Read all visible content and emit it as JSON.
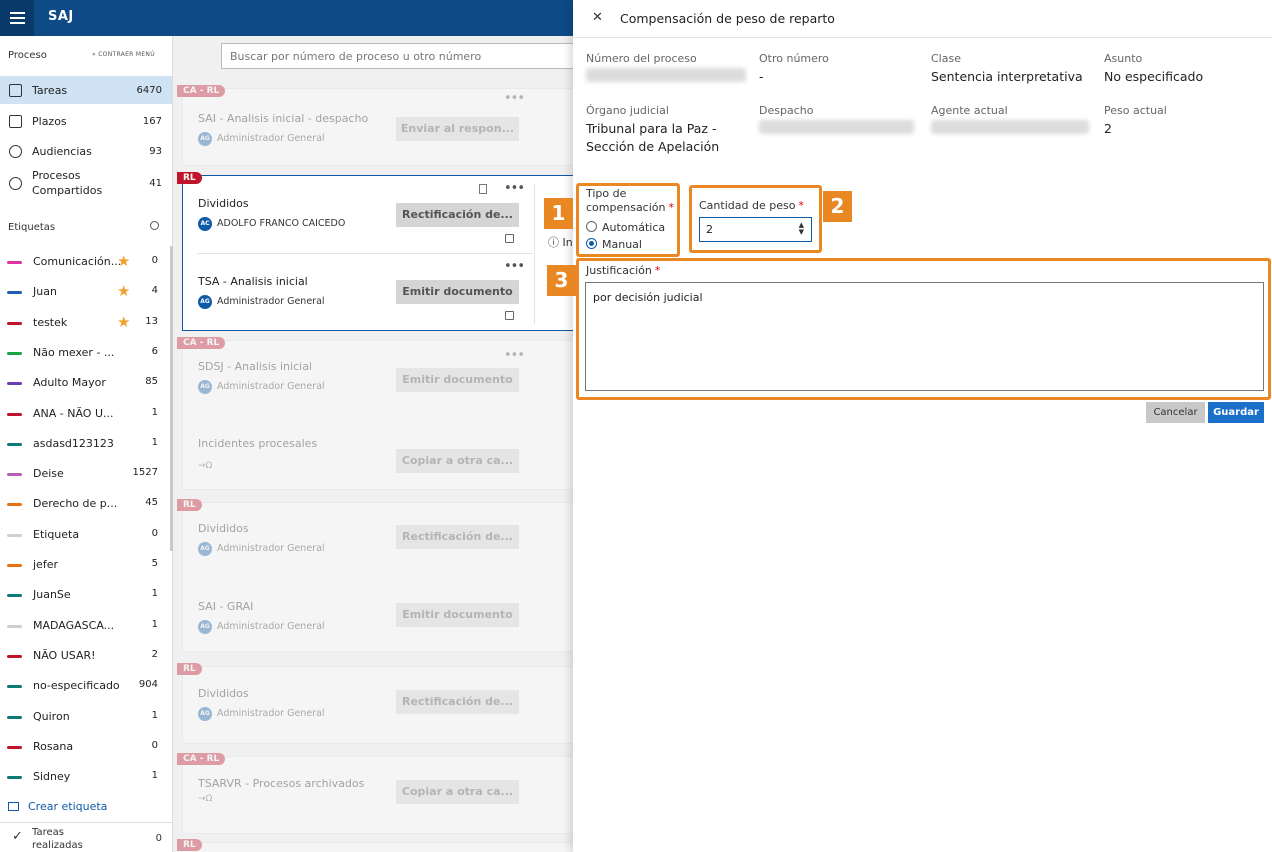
{
  "app": {
    "name": "SAJ"
  },
  "sidebar": {
    "title": "Proceso",
    "collapse_label": "CONTRAER MENÚ",
    "nav": [
      {
        "label": "Tareas",
        "count": "6470",
        "active": true
      },
      {
        "label": "Plazos",
        "count": "167"
      },
      {
        "label": "Audiencias",
        "count": "93"
      },
      {
        "label": "Procesos Compartidos",
        "count": "41"
      }
    ],
    "tags_title": "Etiquetas",
    "tags": [
      {
        "label": "Comunicación...",
        "count": "0",
        "color": "#e0339a",
        "starred": true
      },
      {
        "label": "Juan",
        "count": "4",
        "color": "#1e5fb4",
        "starred": true
      },
      {
        "label": "testek",
        "count": "13",
        "color": "#c0142a",
        "starred": true
      },
      {
        "label": "Não mexer - ...",
        "count": "6",
        "color": "#1aa34a"
      },
      {
        "label": "Adulto Mayor",
        "count": "85",
        "color": "#6a3fb0"
      },
      {
        "label": "ANA - NÃO U...",
        "count": "1",
        "color": "#c0142a"
      },
      {
        "label": "asdasd123123",
        "count": "1",
        "color": "#0b7a78"
      },
      {
        "label": "Deise",
        "count": "1527",
        "color": "#b45fb4"
      },
      {
        "label": "Derecho de p...",
        "count": "45",
        "color": "#e8700f"
      },
      {
        "label": "Etiqueta",
        "count": "0",
        "color": "#d0d0d0"
      },
      {
        "label": "jefer",
        "count": "5",
        "color": "#e8700f"
      },
      {
        "label": "JuanSe",
        "count": "1",
        "color": "#0b7a78"
      },
      {
        "label": "MADAGASCA...",
        "count": "1",
        "color": "#d0d0d0"
      },
      {
        "label": "NÃO USAR!",
        "count": "2",
        "color": "#c0142a"
      },
      {
        "label": "no-especificado",
        "count": "904",
        "color": "#0b7a78"
      },
      {
        "label": "Quiron",
        "count": "1",
        "color": "#0b7a78"
      },
      {
        "label": "Rosana",
        "count": "0",
        "color": "#c0142a"
      },
      {
        "label": "Sidney",
        "count": "1",
        "color": "#0b7a78"
      }
    ],
    "create_tag": "Crear etiqueta",
    "done_label": "Tareas realizadas",
    "done_count": "0"
  },
  "search": {
    "placeholder": "Buscar por número de proceso u otro número"
  },
  "cards": [
    {
      "tag": "CA - RL",
      "task": "SAI - Analisis inicial - despacho",
      "avatar": "AG",
      "user": "Administrador General",
      "button": "Enviar al respon..."
    },
    {
      "tag": "RL",
      "task1": "Divididos",
      "avatar1": "AC",
      "user1": "ADOLFO FRANCO CAICEDO",
      "button1": "Rectificación de...",
      "task2": "TSA - Analisis inicial",
      "avatar2": "AG",
      "user2": "Administrador General",
      "button2": "Emitir documento",
      "info": "In"
    },
    {
      "tag": "CA - RL",
      "task1": "SDSJ - Analisis inicial",
      "avatar1": "AG",
      "user1": "Administrador General",
      "button1": "Emitir documento",
      "task2": "Incidentes procesales",
      "button2": "Copiar a otra ca..."
    },
    {
      "tag": "RL",
      "task1": "Divididos",
      "avatar1": "AG",
      "user1": "Administrador General",
      "button1": "Rectificación de...",
      "task2": "SAI - GRAI",
      "avatar2": "AG",
      "user2": "Administrador General",
      "button2": "Emitir documento"
    },
    {
      "tag": "RL",
      "task": "Divididos",
      "avatar": "AG",
      "user": "Administrador General",
      "button": "Rectificación de..."
    },
    {
      "tag": "CA - RL",
      "task": "TSARVR - Procesos archivados",
      "button": "Copiar a otra ca..."
    },
    {
      "tag": "RL"
    }
  ],
  "dialog": {
    "title": "Compensación de peso de reparto",
    "fields": {
      "numero_label": "Número del proceso",
      "otro_label": "Otro número",
      "otro_value": "-",
      "clase_label": "Clase",
      "clase_value": "Sentencia interpretativa",
      "asunto_label": "Asunto",
      "asunto_value": "No especificado",
      "organo_label": "Órgano judicial",
      "organo_value": "Tribunal para la Paz - Sección de Apelación",
      "despacho_label": "Despacho",
      "agente_label": "Agente actual",
      "peso_label": "Peso actual",
      "peso_value": "2"
    },
    "tipo_label": "Tipo de compensación",
    "radio_auto": "Automática",
    "radio_manual": "Manual",
    "selected": "Manual",
    "cantidad_label": "Cantidad de peso",
    "cantidad_value": "2",
    "justificacion_label": "Justificación",
    "justificacion_value": "por decisión judicial",
    "cancel": "Cancelar",
    "save": "Guardar",
    "required_mark": "*"
  },
  "annotations": {
    "n1": "1",
    "n2": "2",
    "n3": "3",
    "color": "#e98722"
  }
}
